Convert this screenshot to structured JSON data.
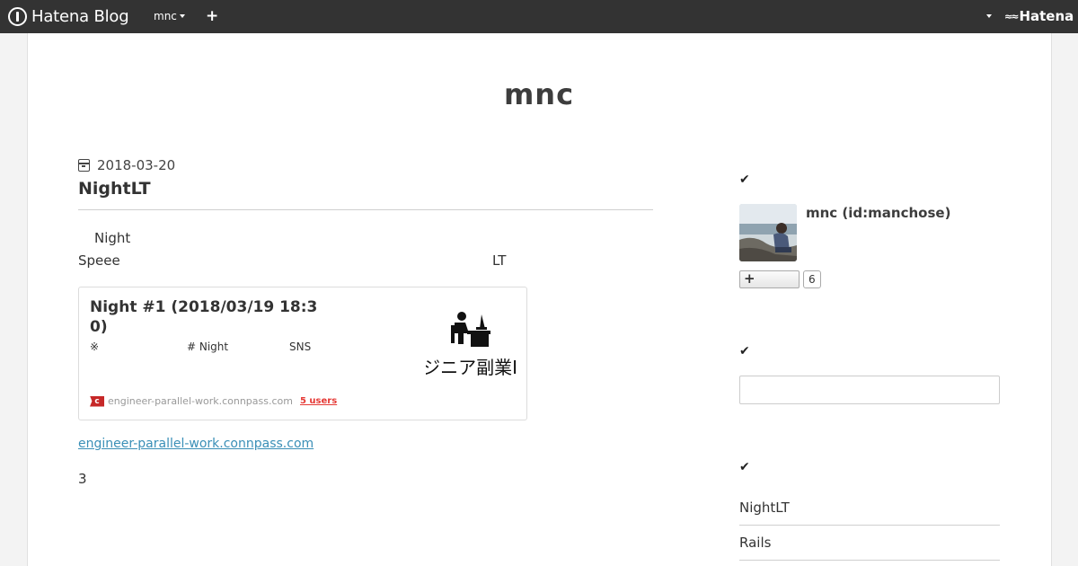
{
  "header": {
    "logo_text": "Hatena Blog",
    "user_menu": "mnc",
    "add_label": "+",
    "brand": "Hatena"
  },
  "blog": {
    "title": "mnc"
  },
  "entry": {
    "date": "2018-03-20",
    "title": "NightLT",
    "para1": "Night",
    "para2_left": "Speee",
    "para2_right": "LT",
    "card": {
      "title": "Night #1  (2018/03/19 18:30)",
      "desc_1": "※",
      "desc_2": "# Night",
      "desc_3": "SNS",
      "thumb_text": "ジニア副業I",
      "favicon_letter": "c",
      "domain": "engineer-parallel-work.connpass.com",
      "users": "5 users"
    },
    "link": "engineer-parallel-work.connpass.com",
    "number": "3"
  },
  "sidebar": {
    "check_icon": "✔",
    "profile": {
      "name": "mnc (id:manchose)",
      "subscribe_plus": "+",
      "subscriber_count": "6"
    },
    "search": {
      "placeholder": ""
    },
    "categories": [
      "NightLT",
      "Rails"
    ]
  }
}
